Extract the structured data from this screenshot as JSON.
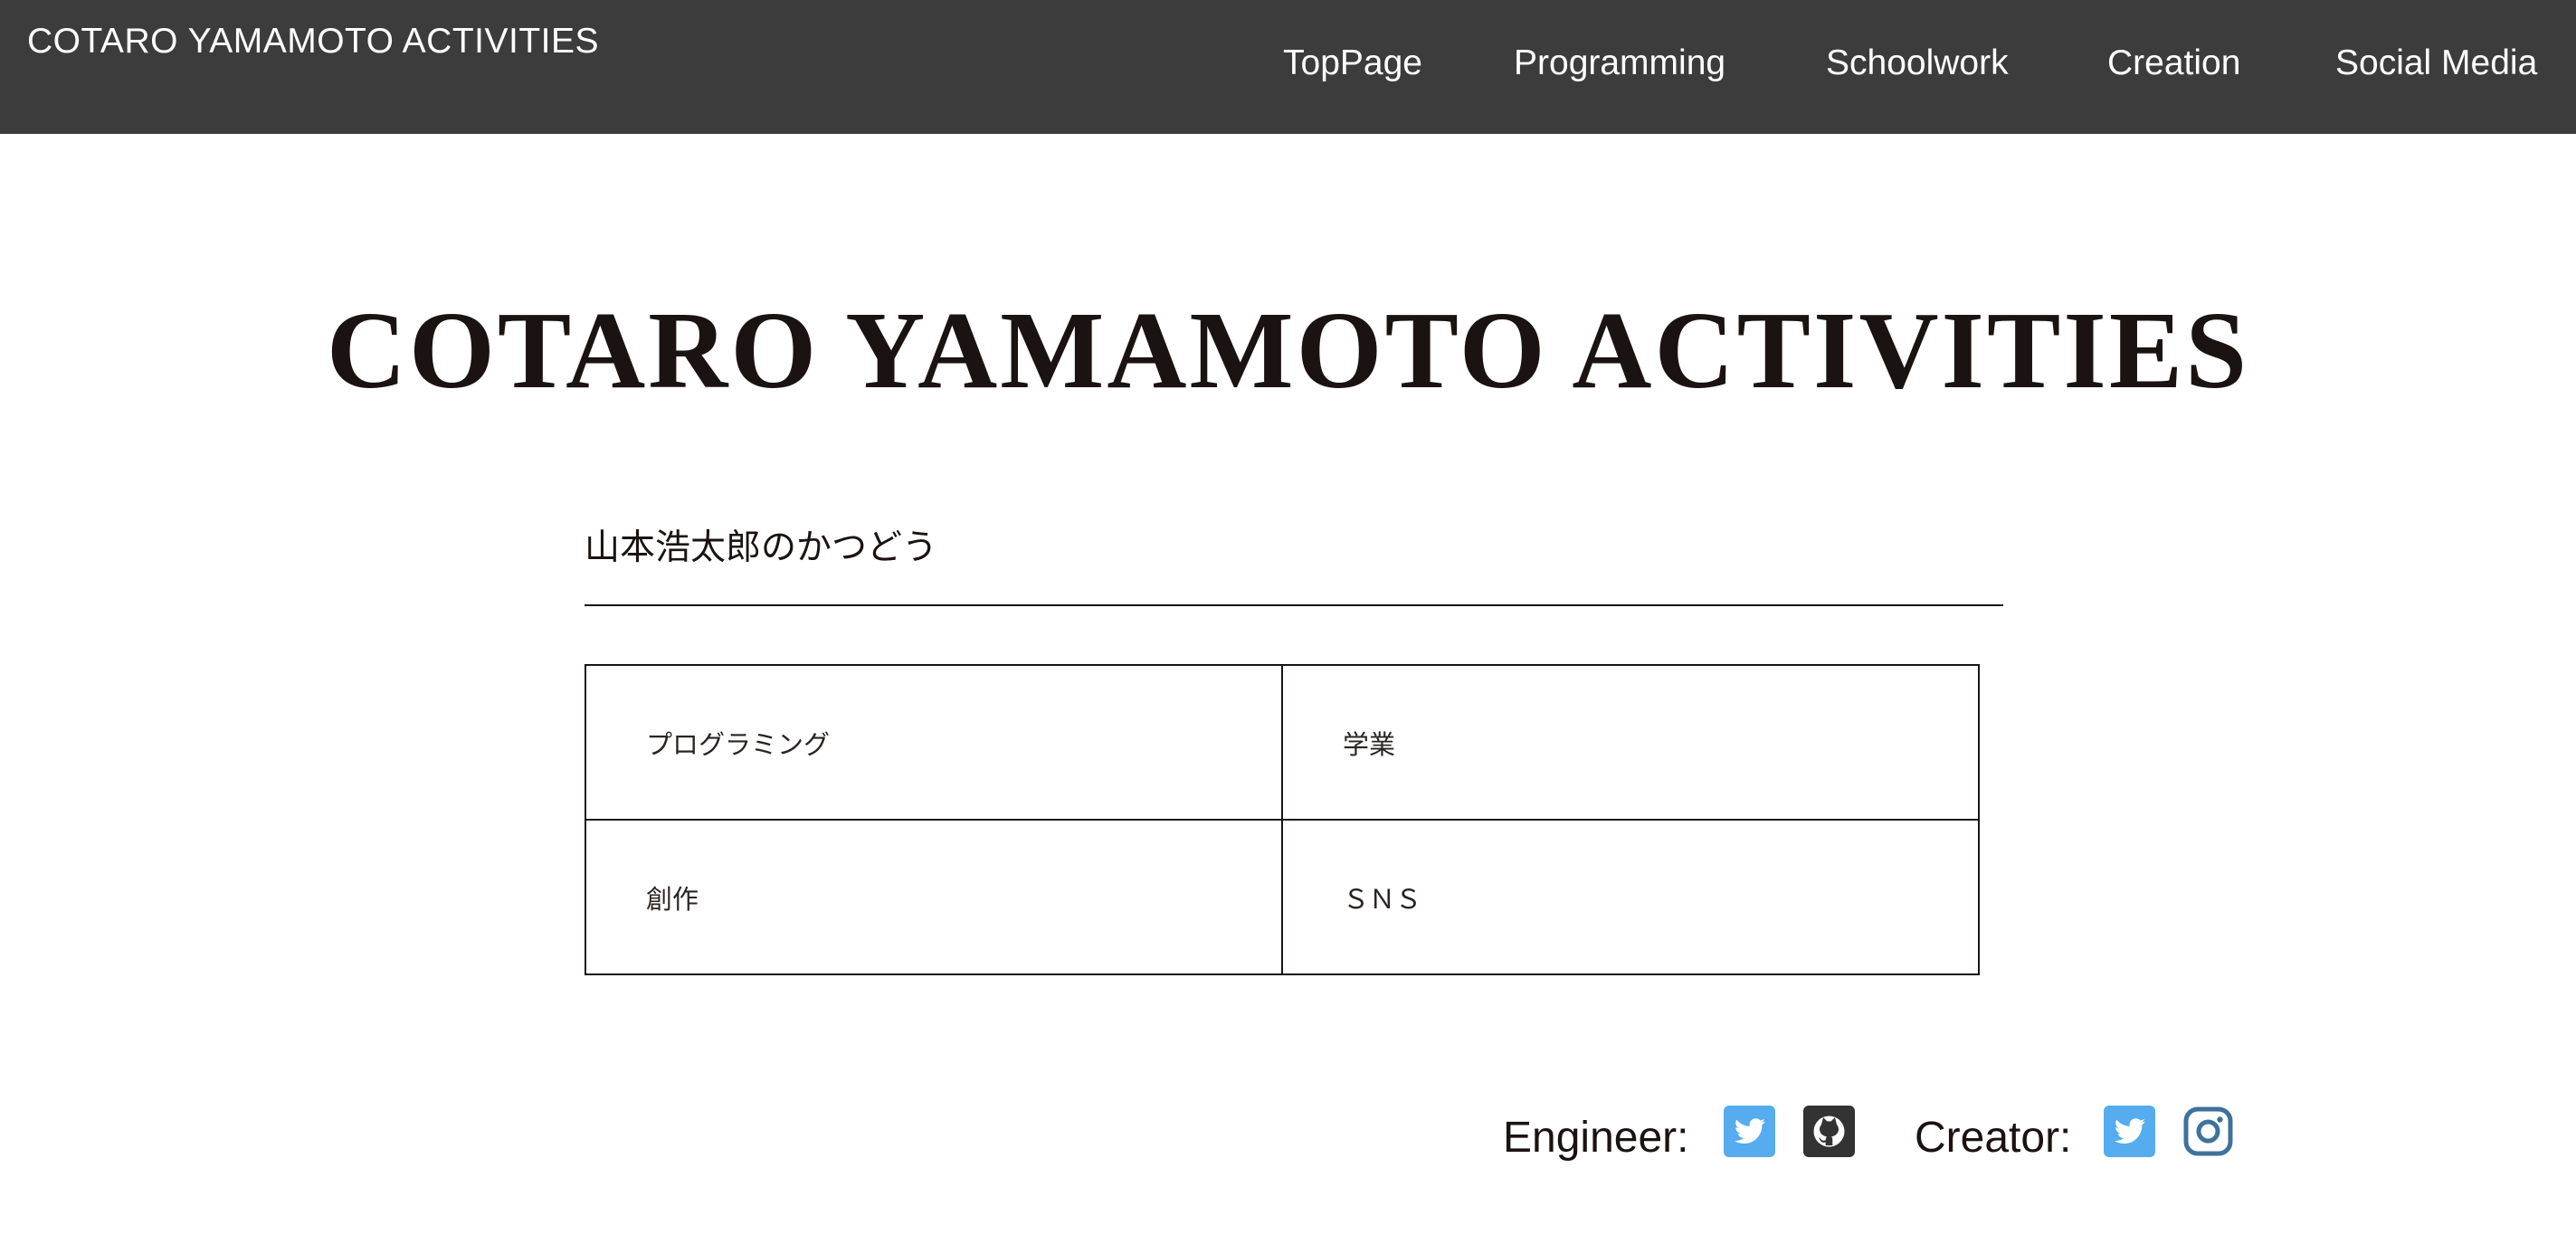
{
  "header": {
    "site_name": "COTARO YAMAMOTO ACTIVITIES",
    "nav": [
      {
        "label": "TopPage"
      },
      {
        "label": "Programming"
      },
      {
        "label": "Schoolwork"
      },
      {
        "label": "Creation"
      },
      {
        "label": "Social Media"
      }
    ]
  },
  "main": {
    "title": "COTARO YAMAMOTO ACTIVITIES",
    "subtitle": "山本浩太郎のかつどう",
    "grid": [
      {
        "label": "プログラミング"
      },
      {
        "label": "学業"
      },
      {
        "label": "創作"
      },
      {
        "label": "ＳＮＳ"
      }
    ]
  },
  "social": {
    "engineer_label": "Engineer:",
    "creator_label": "Creator:",
    "icons": {
      "engineer_twitter": "twitter-icon",
      "engineer_github": "github-icon",
      "creator_twitter": "twitter-icon",
      "creator_instagram": "instagram-icon"
    }
  },
  "colors": {
    "header_bg": "#3c3c3c",
    "text": "#1a1311",
    "twitter": "#55acee",
    "github": "#333333",
    "instagram": "#3f729b"
  }
}
